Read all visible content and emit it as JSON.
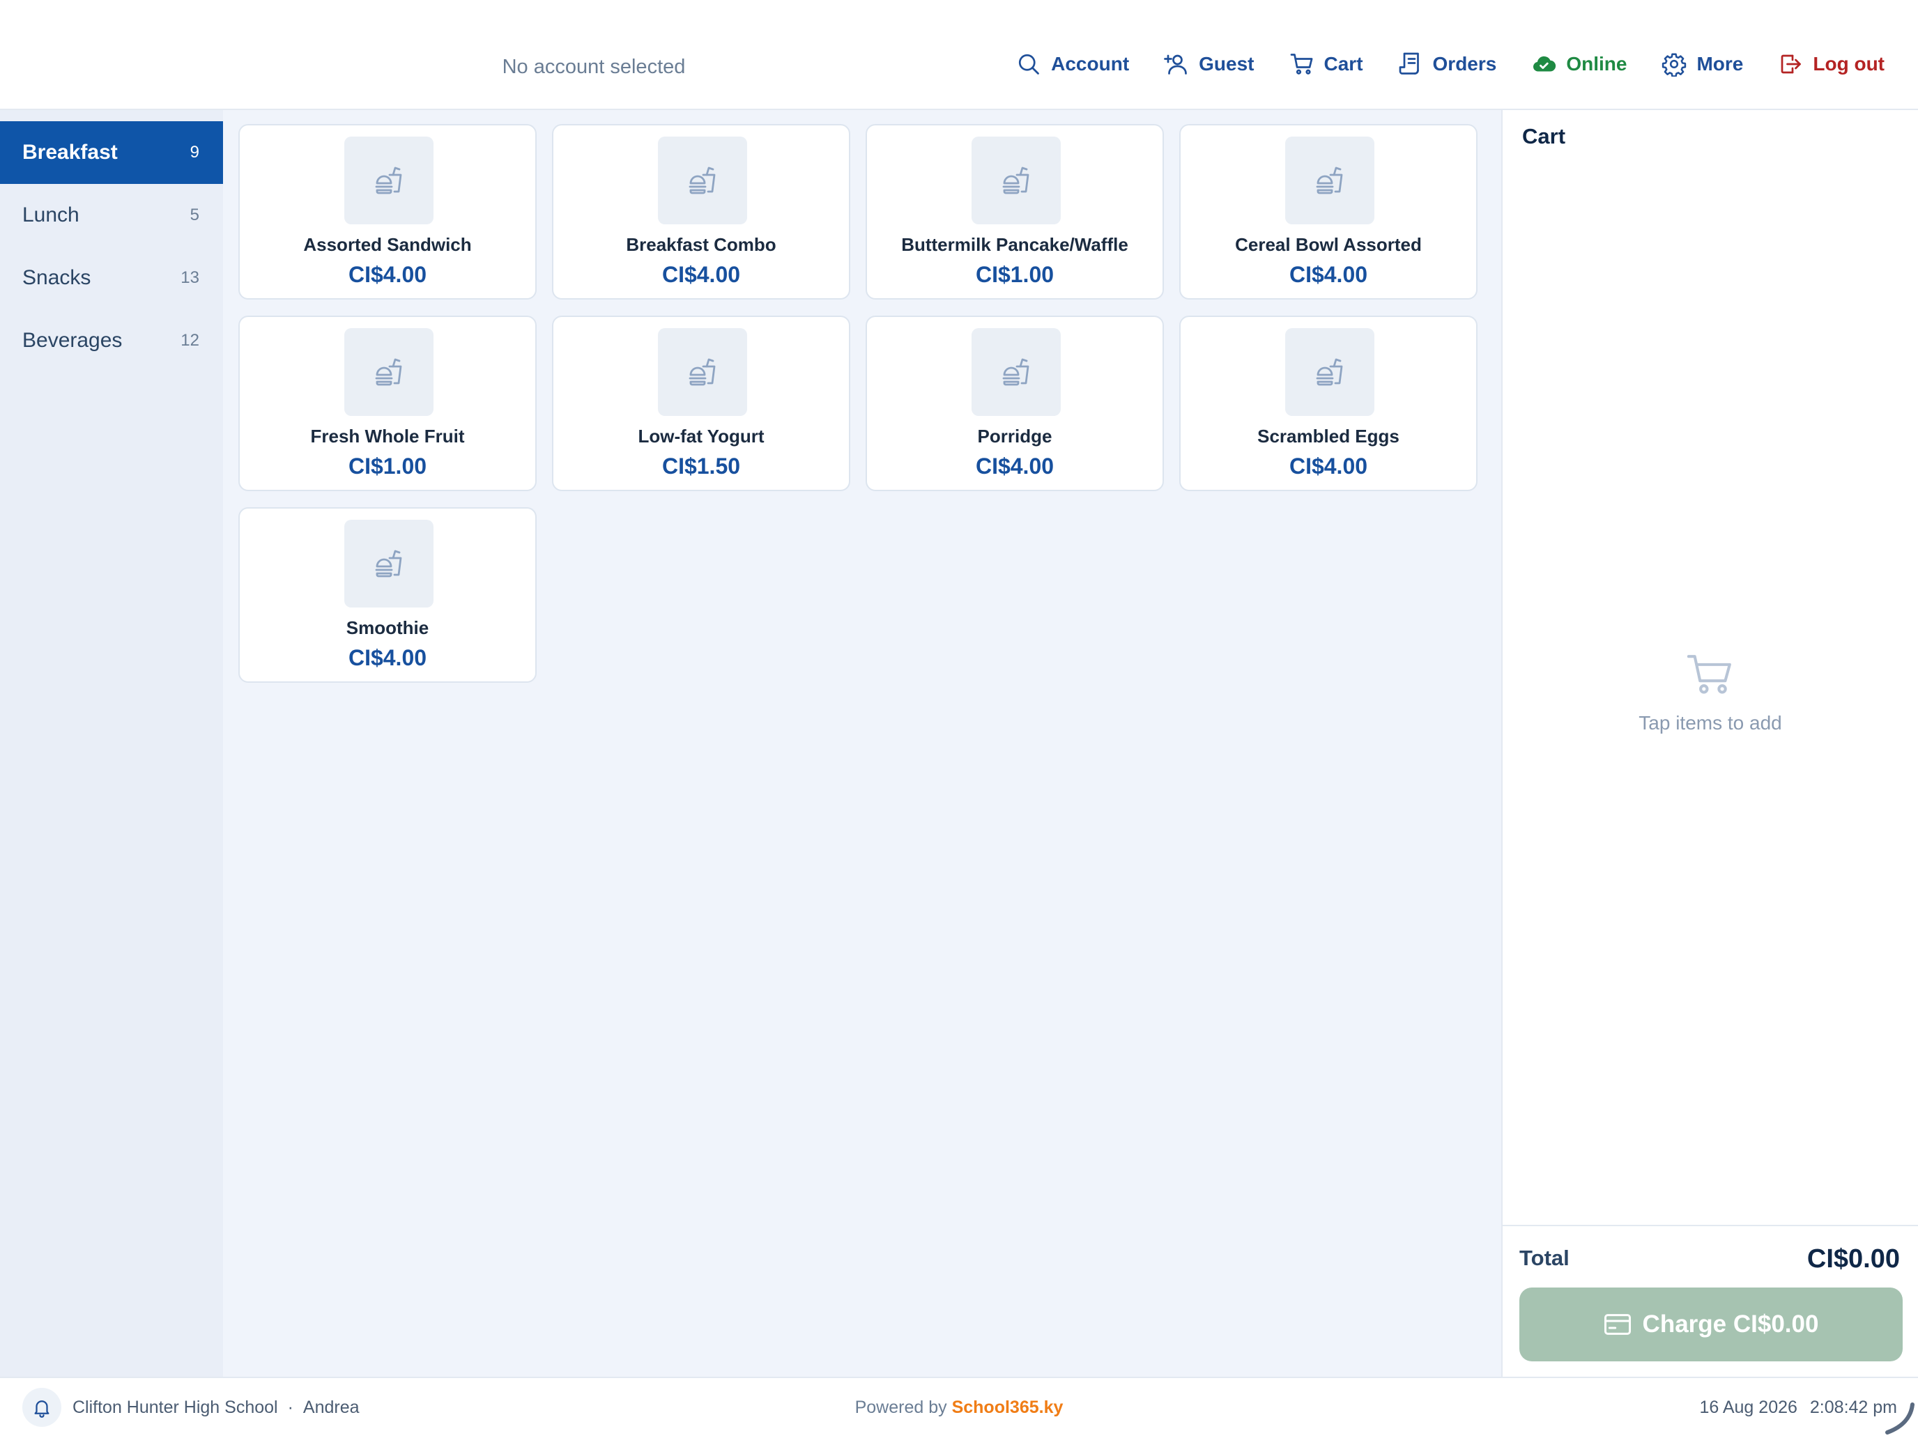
{
  "header": {
    "account_status": "No account selected",
    "nav": [
      {
        "label": "Account",
        "icon": "search-icon"
      },
      {
        "label": "Guest",
        "icon": "add-user-icon"
      },
      {
        "label": "Cart",
        "icon": "cart-icon"
      },
      {
        "label": "Orders",
        "icon": "receipt-icon"
      },
      {
        "label": "Online",
        "icon": "cloud-check-icon",
        "color": "#1f8a43"
      },
      {
        "label": "More",
        "icon": "gear-icon"
      },
      {
        "label": "Log out",
        "icon": "logout-icon",
        "color": "#b42323"
      }
    ]
  },
  "sidebar": {
    "categories": [
      {
        "label": "Breakfast",
        "count": "9",
        "active": true
      },
      {
        "label": "Lunch",
        "count": "5",
        "active": false
      },
      {
        "label": "Snacks",
        "count": "13",
        "active": false
      },
      {
        "label": "Beverages",
        "count": "12",
        "active": false
      }
    ]
  },
  "products": [
    {
      "name": "Assorted Sandwich",
      "price": "CI$4.00"
    },
    {
      "name": "Breakfast Combo",
      "price": "CI$4.00"
    },
    {
      "name": "Buttermilk Pancake/Waffle",
      "price": "CI$1.00"
    },
    {
      "name": "Cereal Bowl Assorted",
      "price": "CI$4.00"
    },
    {
      "name": "Fresh Whole Fruit",
      "price": "CI$1.00"
    },
    {
      "name": "Low-fat Yogurt",
      "price": "CI$1.50"
    },
    {
      "name": "Porridge",
      "price": "CI$4.00"
    },
    {
      "name": "Scrambled Eggs",
      "price": "CI$4.00"
    },
    {
      "name": "Smoothie",
      "price": "CI$4.00"
    }
  ],
  "cart": {
    "title": "Cart",
    "empty_text": "Tap items to add",
    "total_label": "Total",
    "total_value": "CI$0.00",
    "charge_label": "Charge CI$0.00"
  },
  "footer": {
    "school": "Clifton Hunter High School",
    "separator": "·",
    "user": "Andrea",
    "powered_by": "Powered by",
    "brand": "School365.ky",
    "date": "16 Aug 2026",
    "time": "2:08:42 pm"
  },
  "colors": {
    "accent": "#0f55a8",
    "price": "#17509e",
    "online": "#1f8a43",
    "logout": "#b42323",
    "brand": "#f07d16",
    "charge_disabled": "#a6c3b1"
  }
}
